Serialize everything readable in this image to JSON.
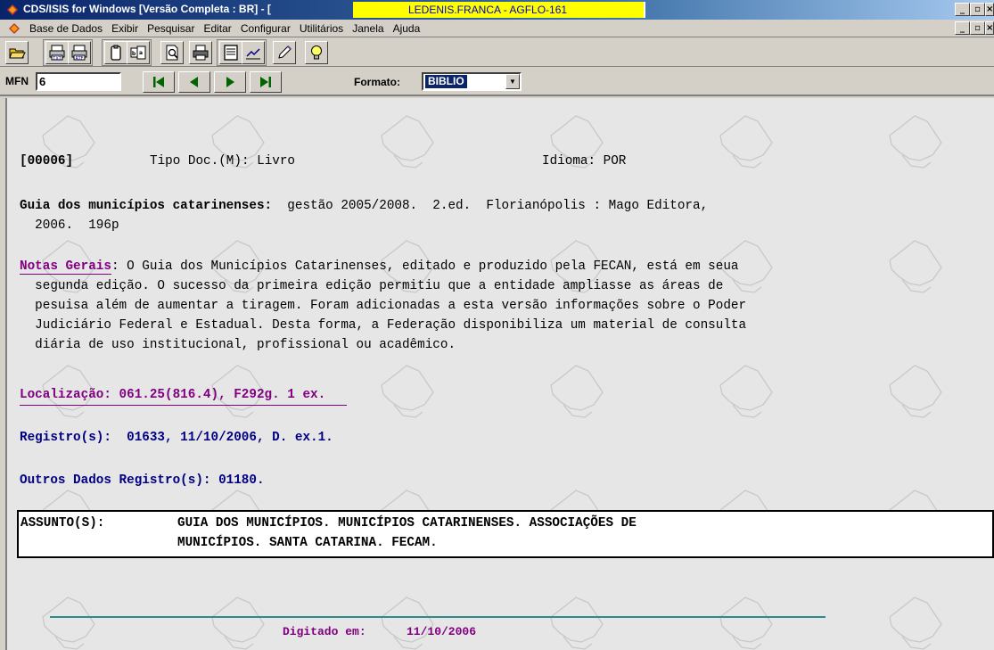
{
  "window": {
    "title": "CDS/ISIS for Windows [Versão Completa : BR] - [",
    "user_badge": "LEDENIS.FRANCA - AGFLO-161",
    "buttons": [
      "_",
      "□",
      "✕"
    ]
  },
  "menu": {
    "items": [
      "Base de Dados",
      "Exibir",
      "Pesquisar",
      "Editar",
      "Configurar",
      "Utilitários",
      "Janela",
      "Ajuda"
    ]
  },
  "toolbar": {
    "buttons": [
      "open-folder",
      "export-txt",
      "export-rtf",
      "copy",
      "paste",
      "print-preview",
      "print",
      "display",
      "edit",
      "pencil",
      "hint"
    ]
  },
  "navbar": {
    "mfn_label": "MFN",
    "mfn_value": "6",
    "formato_label": "Formato:",
    "formato_value": "BIBLIO"
  },
  "record": {
    "id": "[00006]",
    "tipo_doc": "Tipo Doc.(M): Livro",
    "idioma": "Idioma: POR",
    "title_label": "Guia dos municípios catarinenses:",
    "title_rest": "  gestão 2005/2008.  2.ed.  Florianópolis : Mago Editora,",
    "title_line2": "  2006.  196p",
    "notes_label": "Notas Gerais",
    "notes_line1": ": O Guia dos Municípios Catarinenses, editado e produzido pela FECAN, está em seua",
    "notes_line2": "  segunda edição. O sucesso da primeira edição permitiu que a entidade ampliasse as áreas de",
    "notes_line3": "  pesuisa além de aumentar a tiragem. Foram adicionadas a esta versão informações sobre o Poder",
    "notes_line4": "  Judiciário Federal e Estadual. Desta forma, a Federação disponibiliza um material de consulta",
    "notes_line5": "  diária de uso institucional, profissional ou acadêmico.",
    "localizacao": "Localização: 061.25(816.4), F292g. 1 ex.",
    "registros": "Registro(s):  01633, 11/10/2006, D. ex.1.",
    "outros": "Outros Dados Registro(s): 01180.",
    "assunto_label": "ASSUNTO(S):",
    "assunto_line1": "GUIA DOS MUNICÍPIOS. MUNICÍPIOS CATARINENSES. ASSOCIAÇÕES DE",
    "assunto_line2": "MUNICÍPIOS. SANTA CATARINA. FECAM.",
    "digitado_label": "Digitado em:",
    "digitado_value": "11/10/2006"
  },
  "colors": {
    "title_bar": "#0a246a",
    "user_badge_bg": "#ffff00",
    "label_purple": "#800080",
    "label_navy": "#000080",
    "content_bg": "#e6e6e6",
    "footer_line": "#2f8b8b"
  }
}
